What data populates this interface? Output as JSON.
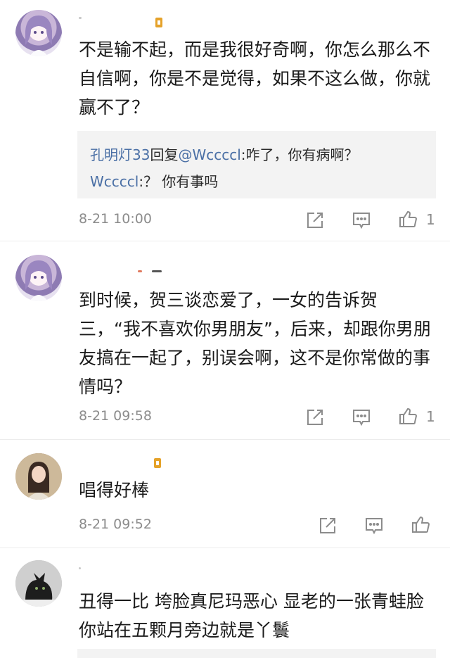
{
  "comments": [
    {
      "text": "不是输不起，而是我很好奇啊，你怎么那么不自信啊，你是不是觉得，如果不这么做，你就赢不了？",
      "replies": [
        {
          "name": "孔明灯33",
          "connector": "回复",
          "mention": "@Wccccl",
          "body": ":咋了，你有病啊？"
        },
        {
          "name": "Wccccl",
          "connector": "",
          "mention": "",
          "body": ":？ 你有事吗"
        }
      ],
      "time": "8-21 10:00",
      "likes": "1",
      "avatar": "anime-girl-avatar"
    },
    {
      "text": "到时候，贺三谈恋爱了，一女的告诉贺三，“我不喜欢你男朋友”，后来，却跟你男朋友搞在一起了，别误会啊，这不是你常做的事情吗？",
      "time": "8-21 09:58",
      "likes": "1",
      "avatar": "anime-girl-avatar"
    },
    {
      "text": "唱得好棒",
      "time": "8-21 09:52",
      "likes": "",
      "avatar": "photo-girl-avatar"
    },
    {
      "text": "丑得一比 垮脸真尼玛恶心 显老的一张青蛙脸 你站在五颗月旁边就是丫鬟",
      "avatar": "cat-photo-avatar"
    }
  ],
  "icons": {
    "share": "share-icon",
    "comment": "comment-icon",
    "like": "thumbs-up-icon",
    "badge": "level-badge-icon"
  },
  "colors": {
    "link": "#4a6fa5",
    "meta": "#8c8c8c",
    "reply_bg": "#f3f3f3",
    "badge": "#e5a22a"
  }
}
